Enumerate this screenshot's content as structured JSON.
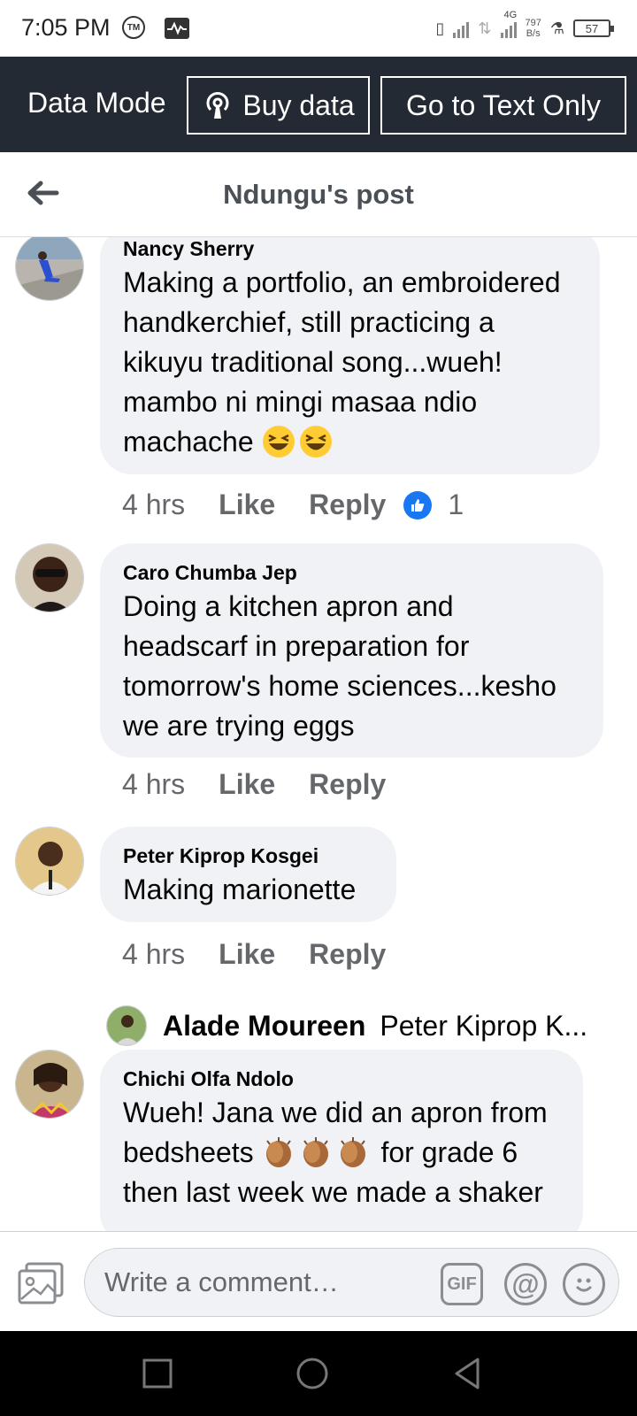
{
  "status_bar": {
    "time": "7:05 PM",
    "tm_icon": "TM",
    "network_type": "4G",
    "speed_value": "797",
    "speed_unit": "B/s",
    "battery": "57"
  },
  "data_mode_bar": {
    "label": "Data Mode",
    "buy_data_label": "Buy data",
    "text_only_label": "Go to Text Only"
  },
  "header": {
    "title": "Ndungu's post"
  },
  "comments": [
    {
      "author": "Nancy Sherry",
      "text": "Making a portfolio, an embroidered handkerchief, still practicing a kikuyu traditional song...wueh! mambo ni mingi masaa ndio machache",
      "time": "4 hrs",
      "like": "Like",
      "reply": "Reply",
      "reactions": "1"
    },
    {
      "author": "Caro Chumba Jep",
      "text": "Doing a kitchen apron and headscarf in preparation for tomorrow's home sciences...kesho we are trying eggs",
      "time": "4 hrs",
      "like": "Like",
      "reply": "Reply"
    },
    {
      "author": "Peter Kiprop Kosgei",
      "text": "Making marionette",
      "time": "4 hrs",
      "like": "Like",
      "reply": "Reply"
    },
    {
      "author": "Chichi Olfa Ndolo",
      "text_line1": "Wueh! Jana we did an apron from",
      "text_line2_a": "bedsheets",
      "text_line2_b": "for grade 6",
      "text_line3": "then last week we made a shaker"
    }
  ],
  "reply_preview": {
    "name": "Alade Moureen",
    "text": "Peter Kiprop K..."
  },
  "composer": {
    "placeholder": "Write a comment…",
    "gif_label": "GIF",
    "at_label": "@"
  },
  "colors": {
    "data_bar_bg": "#242a33",
    "bubble_bg": "#f0f2f5",
    "like_blue": "#1877f2",
    "meta_gray": "#65676b"
  }
}
